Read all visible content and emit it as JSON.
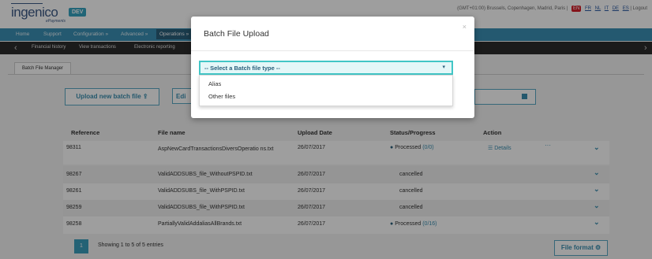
{
  "brand": {
    "logo": "ingenico",
    "sub": "ePayments",
    "badge": "DEV"
  },
  "top_right": {
    "timezone": "(GMT+01:00) Brussels, Copenhagen, Madrid, Paris",
    "languages": [
      "EN",
      "FR",
      "NL",
      "IT",
      "DE",
      "ES"
    ],
    "logout": "Logout"
  },
  "nav": {
    "items": [
      "Home",
      "Support",
      "Configuration »",
      "Advanced »",
      "Operations »"
    ]
  },
  "subnav": {
    "items": [
      "Financial history",
      "View transactions",
      "Electronic reporting"
    ]
  },
  "tab": {
    "label": "Batch File Manager"
  },
  "actions": {
    "upload_label": "Upload new batch file",
    "edit_label": "Edi",
    "cancel_label": "ncel"
  },
  "table": {
    "headers": [
      "Reference",
      "File name",
      "Upload Date",
      "Status/Progress",
      "Action"
    ],
    "rows": [
      {
        "reference": "98311",
        "file": "AspNewCardTransactionsDiversOperatio ns.txt",
        "date": "26/07/2017",
        "status": "Processed",
        "progress": "(0/0)",
        "action": "Details"
      },
      {
        "reference": "98267",
        "file": "ValidADDSUBS_file_WithoutPSPID.txt",
        "date": "26/07/2017",
        "status": "cancelled",
        "progress": "",
        "action": ""
      },
      {
        "reference": "98261",
        "file": "ValidADDSUBS_file_WithPSPID.txt",
        "date": "26/07/2017",
        "status": "cancelled",
        "progress": "",
        "action": ""
      },
      {
        "reference": "98259",
        "file": "ValidADDSUBS_file_WithPSPID.txt",
        "date": "26/07/2017",
        "status": "cancelled",
        "progress": "",
        "action": ""
      },
      {
        "reference": "98258",
        "file": "PartiallyValidAddaliasAllBrands.txt",
        "date": "26/07/2017",
        "status": "Processed",
        "progress": "(0/16)",
        "action": ""
      }
    ]
  },
  "pagination": {
    "page": "1",
    "showing": "Showing 1 to 5 of 5 entries"
  },
  "file_format_label": "File format",
  "modal": {
    "title": "Batch File Upload",
    "close": "×",
    "select_placeholder": "-- Select a Batch file type --",
    "options": [
      "Alias",
      "Other files"
    ]
  },
  "colors": {
    "accent": "#3a90b5",
    "select_border": "#42c6c6",
    "active_lang": "#d6202b"
  }
}
